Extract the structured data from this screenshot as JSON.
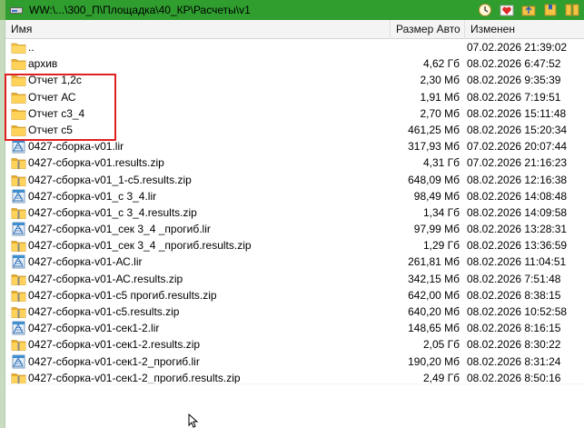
{
  "window": {
    "path": "WW:\\...\\300_П\\Площадка\\40_КР\\Расчеты\\v1"
  },
  "toolbar": {
    "buttons": [
      {
        "name": "history-button",
        "icon": "clock-icon"
      },
      {
        "name": "favorites-button",
        "icon": "heart-icon"
      },
      {
        "name": "parent-folder-button",
        "icon": "folder-up-icon"
      },
      {
        "name": "bookmark-button",
        "icon": "bookmark-icon"
      },
      {
        "name": "split-view-button",
        "icon": "split-icon"
      }
    ]
  },
  "columns": {
    "name": "Имя",
    "size": "Размер Авто",
    "modified": "Изменен"
  },
  "files": [
    {
      "name": "..",
      "size": "",
      "date": "07.02.2026 21:39:02",
      "type": "parent"
    },
    {
      "name": "архив",
      "size": "4,62 Гб",
      "date": "08.02.2026 6:47:52",
      "type": "folder"
    },
    {
      "name": "Отчет 1,2с",
      "size": "2,30 Мб",
      "date": "08.02.2026 9:35:39",
      "type": "folder"
    },
    {
      "name": "Отчет АС",
      "size": "1,91 Мб",
      "date": "08.02.2026 7:19:51",
      "type": "folder"
    },
    {
      "name": "Отчет с3_4",
      "size": "2,70 Мб",
      "date": "08.02.2026 15:11:48",
      "type": "folder"
    },
    {
      "name": "Отчет с5",
      "size": "461,25 Мб",
      "date": "08.02.2026 15:20:34",
      "type": "folder"
    },
    {
      "name": "0427-сборка-v01.lir",
      "size": "317,93 Мб",
      "date": "07.02.2026 20:07:44",
      "type": "lir"
    },
    {
      "name": "0427-сборка-v01.results.zip",
      "size": "4,31 Гб",
      "date": "07.02.2026 21:16:23",
      "type": "zip"
    },
    {
      "name": "0427-сборка-v01_1-с5.results.zip",
      "size": "648,09 Мб",
      "date": "08.02.2026 12:16:38",
      "type": "zip"
    },
    {
      "name": "0427-сборка-v01_с 3_4.lir",
      "size": "98,49 Мб",
      "date": "08.02.2026 14:08:48",
      "type": "lir"
    },
    {
      "name": "0427-сборка-v01_с 3_4.results.zip",
      "size": "1,34 Гб",
      "date": "08.02.2026 14:09:58",
      "type": "zip"
    },
    {
      "name": "0427-сборка-v01_сек 3_4 _прогиб.lir",
      "size": "97,99 Мб",
      "date": "08.02.2026 13:28:31",
      "type": "lir"
    },
    {
      "name": "0427-сборка-v01_сек 3_4 _прогиб.results.zip",
      "size": "1,29 Гб",
      "date": "08.02.2026 13:36:59",
      "type": "zip"
    },
    {
      "name": "0427-сборка-v01-АС.lir",
      "size": "261,81 Мб",
      "date": "08.02.2026 11:04:51",
      "type": "lir"
    },
    {
      "name": "0427-сборка-v01-АС.results.zip",
      "size": "342,15 Мб",
      "date": "08.02.2026 7:51:48",
      "type": "zip"
    },
    {
      "name": "0427-сборка-v01-с5 прогиб.results.zip",
      "size": "642,00 Мб",
      "date": "08.02.2026 8:38:15",
      "type": "zip"
    },
    {
      "name": "0427-сборка-v01-с5.results.zip",
      "size": "640,20 Мб",
      "date": "08.02.2026 10:52:58",
      "type": "zip"
    },
    {
      "name": "0427-сборка-v01-сек1-2.lir",
      "size": "148,65 Мб",
      "date": "08.02.2026 8:16:15",
      "type": "lir"
    },
    {
      "name": "0427-сборка-v01-сек1-2.results.zip",
      "size": "2,05 Гб",
      "date": "08.02.2026 8:30:22",
      "type": "zip"
    },
    {
      "name": "0427-сборка-v01-сек1-2_прогиб.lir",
      "size": "190,20 Мб",
      "date": "08.02.2026 8:31:24",
      "type": "lir"
    },
    {
      "name": "0427-сборка-v01-сек1-2_прогиб.results.zip",
      "size": "2,49 Гб",
      "date": "08.02.2026 8:50:16",
      "type": "zip"
    }
  ],
  "colors": {
    "path_bar": "#2f9e2f",
    "highlight": "#e02020",
    "folder": "#f5c242"
  }
}
